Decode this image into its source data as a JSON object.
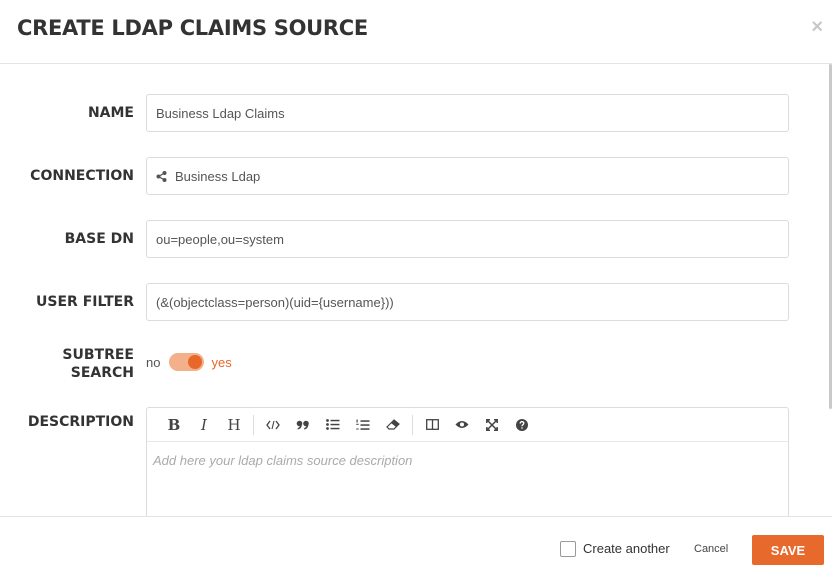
{
  "modal": {
    "title": "CREATE LDAP CLAIMS SOURCE",
    "close_glyph": "×"
  },
  "form": {
    "name": {
      "label": "NAME",
      "value": "Business Ldap Claims"
    },
    "connection": {
      "label": "CONNECTION",
      "value": "Business Ldap",
      "icon": "share-icon"
    },
    "base_dn": {
      "label": "BASE DN",
      "value": "ou=people,ou=system"
    },
    "user_filter": {
      "label": "USER FILTER",
      "value": "(&(objectclass=person)(uid={username}))"
    },
    "subtree_search": {
      "label_line1": "SUBTREE",
      "label_line2": "SEARCH",
      "off_label": "no",
      "on_label": "yes",
      "value": true
    },
    "description": {
      "label": "DESCRIPTION",
      "placeholder": "Add here your ldap claims source description",
      "toolbar": [
        "bold",
        "italic",
        "heading",
        "code",
        "quote",
        "unordered-list",
        "ordered-list",
        "clean-block",
        "side-by-side",
        "preview",
        "fullscreen",
        "guide"
      ],
      "toolbar_text": {
        "bold": "B",
        "italic": "I",
        "heading": "H"
      }
    }
  },
  "footer": {
    "create_another_label": "Create another",
    "create_another_checked": false,
    "cancel_label": "Cancel",
    "save_label": "SAVE"
  },
  "colors": {
    "accent": "#e8692c",
    "toggle_track": "#f4b08a"
  }
}
